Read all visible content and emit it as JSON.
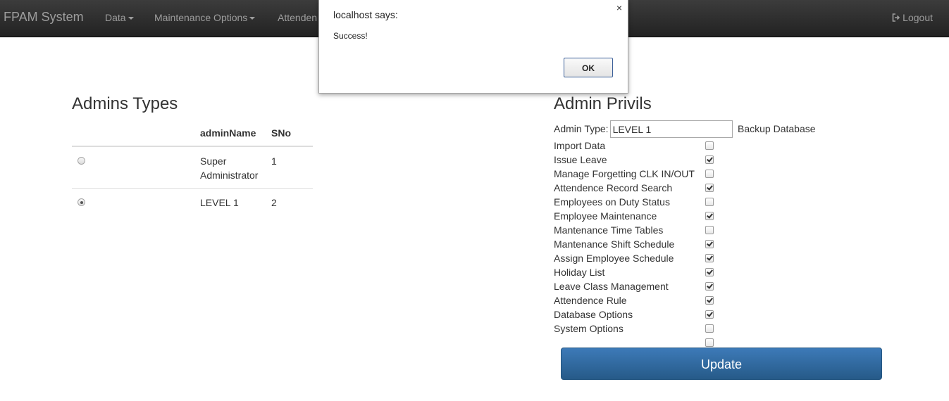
{
  "navbar": {
    "brand": "FPAM System",
    "menus": [
      "Data",
      "Maintenance Options",
      "Attenden"
    ],
    "logout_label": "Logout"
  },
  "dialog": {
    "title": "localhost says:",
    "message": "Success!",
    "ok_label": "OK",
    "close_glyph": "×"
  },
  "admins": {
    "title": "Admins Types",
    "headers": [
      "",
      "adminName",
      "SNo"
    ],
    "rows": [
      {
        "name_line1": "Super",
        "name_line2": "Administrator",
        "sno": "1",
        "selected": false
      },
      {
        "name_line1": "LEVEL 1",
        "name_line2": "",
        "sno": "2",
        "selected": true
      }
    ]
  },
  "privileges": {
    "title": "Admin Privils",
    "admin_type_label": "Admin Type:",
    "admin_type_value": "LEVEL 1",
    "backup_label": "Backup Database",
    "items": [
      {
        "label": "Import Data",
        "checked": false
      },
      {
        "label": "Issue Leave",
        "checked": true
      },
      {
        "label": "Manage Forgetting CLK IN/OUT",
        "checked": false
      },
      {
        "label": "Attendence Record Search",
        "checked": true
      },
      {
        "label": "Employees on Duty Status",
        "checked": false
      },
      {
        "label": "Employee Maintenance",
        "checked": true
      },
      {
        "label": "Mantenance Time Tables",
        "checked": false
      },
      {
        "label": "Mantenance Shift Schedule",
        "checked": true
      },
      {
        "label": "Assign Employee Schedule",
        "checked": true
      },
      {
        "label": "Holiday List",
        "checked": true
      },
      {
        "label": "Leave Class Management",
        "checked": true
      },
      {
        "label": "Attendence Rule",
        "checked": true
      },
      {
        "label": "Database Options",
        "checked": true
      },
      {
        "label": "System Options",
        "checked": false
      }
    ],
    "extra_checkbox_checked": false,
    "update_label": "Update"
  }
}
